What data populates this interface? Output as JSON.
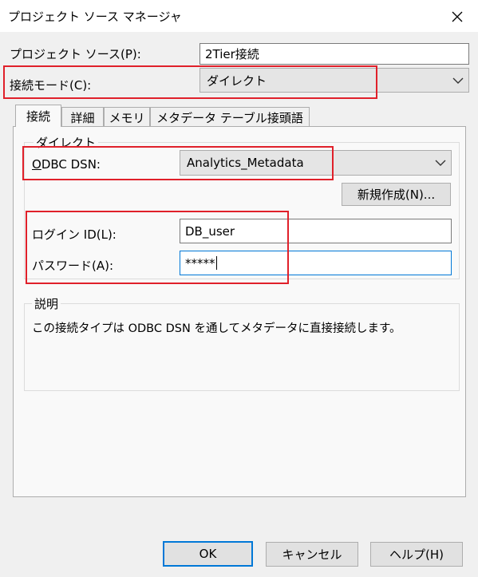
{
  "window": {
    "title": "プロジェクト ソース マネージャ"
  },
  "project_source": {
    "label": "プロジェクト ソース(P):",
    "value": "2Tier接続"
  },
  "connection_mode": {
    "label": "接続モード(C):",
    "value": "ダイレクト"
  },
  "tabs": [
    {
      "label": "接続"
    },
    {
      "label": "詳細"
    },
    {
      "label": "メモリ"
    },
    {
      "label": "メタデータ テーブル接頭語"
    }
  ],
  "direct_group": {
    "title": "ダイレクト"
  },
  "odbc_dsn": {
    "label": "ODBC DSN:",
    "value": "Analytics_Metadata"
  },
  "new_button": {
    "label": "新規作成(N)..."
  },
  "login_id": {
    "label": "ログイン ID(L):",
    "value": "DB_user"
  },
  "password": {
    "label": "パスワード(A):",
    "value": "*****"
  },
  "description": {
    "title": "説明",
    "text": "この接続タイプは ODBC DSN を通してメタデータに直接接続します。"
  },
  "buttons": {
    "ok": "OK",
    "cancel": "キャンセル",
    "help": "ヘルプ(H)"
  },
  "colors": {
    "highlight": "#e0202a",
    "focus": "#0078d7",
    "dialog_bg": "#f0f0f0"
  },
  "icons": {
    "close": "close-icon",
    "dropdown": "chevron-down-icon"
  }
}
